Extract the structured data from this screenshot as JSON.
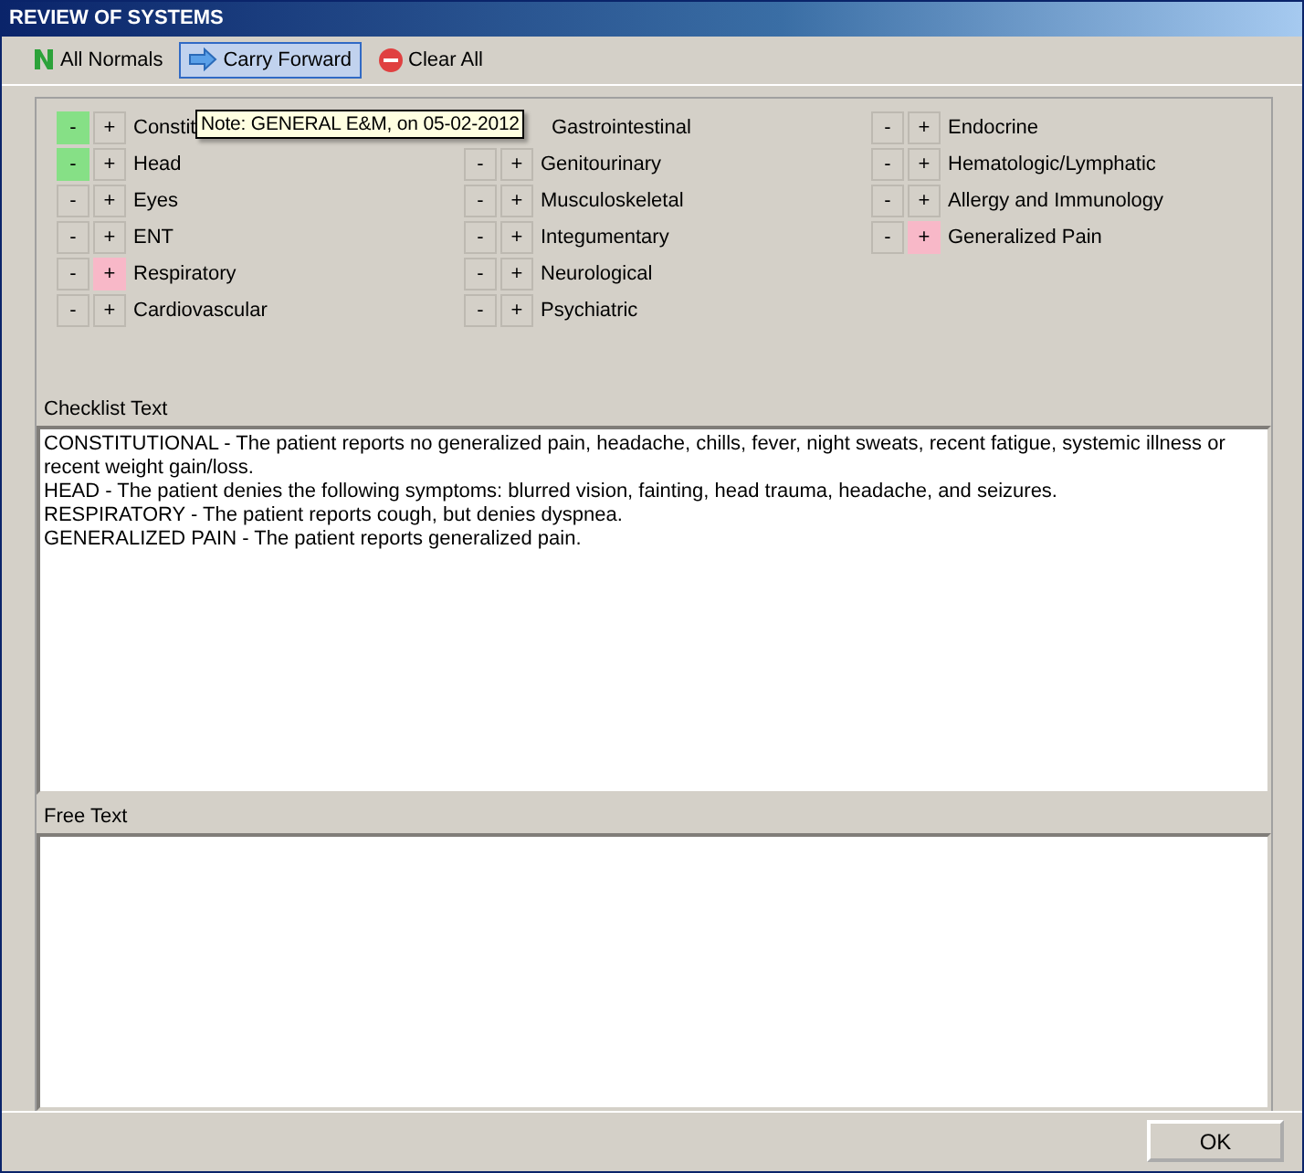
{
  "window": {
    "title": "REVIEW OF SYSTEMS"
  },
  "toolbar": [
    {
      "kind": "normals",
      "label": "All Normals",
      "selected": false
    },
    {
      "kind": "forward",
      "label": "Carry Forward",
      "selected": true
    },
    {
      "kind": "clear",
      "label": "Clear All",
      "selected": false
    }
  ],
  "tooltip": "Note: GENERAL E&M, on 05-02-2012",
  "systems": [
    [
      {
        "label": "Constit",
        "normal": true,
        "positive": false
      },
      {
        "label": "Head",
        "normal": true,
        "positive": false
      },
      {
        "label": "Eyes",
        "normal": false,
        "positive": false
      },
      {
        "label": "ENT",
        "normal": false,
        "positive": false
      },
      {
        "label": "Respiratory",
        "normal": false,
        "positive": true
      },
      {
        "label": "Cardiovascular",
        "normal": false,
        "positive": false
      }
    ],
    [
      {
        "kind": "covered",
        "label": "Gastrointestinal"
      },
      {
        "label": "Genitourinary",
        "normal": false,
        "positive": false
      },
      {
        "label": "Musculoskeletal",
        "normal": false,
        "positive": false
      },
      {
        "label": "Integumentary",
        "normal": false,
        "positive": false
      },
      {
        "label": "Neurological",
        "normal": false,
        "positive": false
      },
      {
        "label": "Psychiatric",
        "normal": false,
        "positive": false
      }
    ],
    [
      {
        "label": "Endocrine",
        "normal": false,
        "positive": false
      },
      {
        "label": "Hematologic/Lymphatic",
        "normal": false,
        "positive": false
      },
      {
        "label": "Allergy and Immunology",
        "normal": false,
        "positive": false
      },
      {
        "label": "Generalized Pain",
        "normal": false,
        "positive": true
      }
    ]
  ],
  "minus_label": "-",
  "plus_label": "+",
  "checklist": {
    "label": "Checklist Text",
    "lines": [
      "CONSTITUTIONAL - The patient reports no generalized pain, headache, chills, fever, night sweats, recent fatigue, systemic illness or recent weight gain/loss.",
      "HEAD - The patient denies the following symptoms: blurred vision, fainting, head trauma, headache, and seizures.",
      "RESPIRATORY - The patient reports cough, but denies dyspnea.",
      "GENERALIZED PAIN - The patient reports generalized pain."
    ]
  },
  "free_text": {
    "label": "Free Text"
  },
  "ok_button": "OK"
}
